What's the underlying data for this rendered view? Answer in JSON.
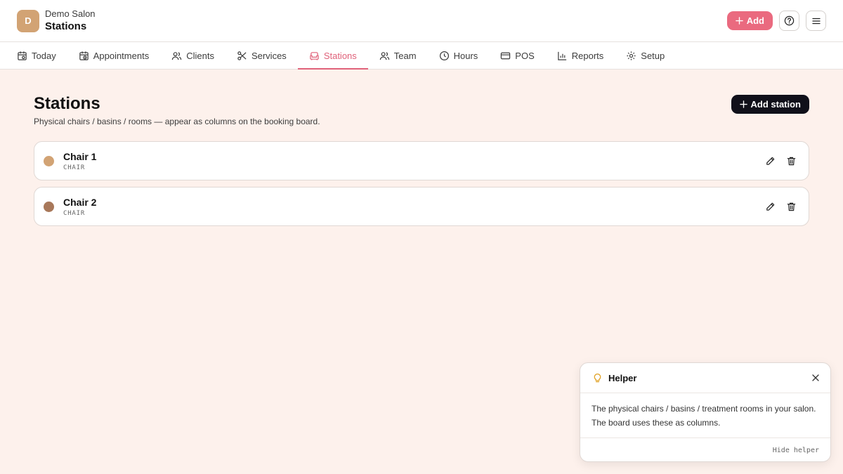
{
  "header": {
    "avatar_letter": "D",
    "salon_name": "Demo Salon",
    "page_name": "Stations",
    "add_label": "Add"
  },
  "nav": {
    "items": [
      {
        "label": "Today",
        "icon": "calendar-icon"
      },
      {
        "label": "Appointments",
        "icon": "calendar-clock-icon"
      },
      {
        "label": "Clients",
        "icon": "users-icon"
      },
      {
        "label": "Services",
        "icon": "scissors-icon"
      },
      {
        "label": "Stations",
        "icon": "sofa-icon",
        "active": true
      },
      {
        "label": "Team",
        "icon": "team-icon"
      },
      {
        "label": "Hours",
        "icon": "clock-icon"
      },
      {
        "label": "POS",
        "icon": "credit-card-icon"
      },
      {
        "label": "Reports",
        "icon": "bar-chart-icon"
      },
      {
        "label": "Setup",
        "icon": "gear-icon"
      }
    ]
  },
  "main": {
    "title": "Stations",
    "subtitle": "Physical chairs / basins / rooms — appear as columns on the booking board.",
    "add_station_label": "Add station",
    "stations": [
      {
        "name": "Chair 1",
        "type": "CHAIR",
        "color": "#d2a374"
      },
      {
        "name": "Chair 2",
        "type": "CHAIR",
        "color": "#a8785a"
      }
    ]
  },
  "helper": {
    "title": "Helper",
    "body": "The physical chairs / basins / treatment rooms in your salon. The board uses these as columns.",
    "hide_label": "Hide helper"
  },
  "colors": {
    "accent": "#e0627a",
    "add_button": "#ea6a7f",
    "dark_button": "#10101a",
    "background": "#fdf1ec",
    "helper_icon": "#e0a020"
  }
}
